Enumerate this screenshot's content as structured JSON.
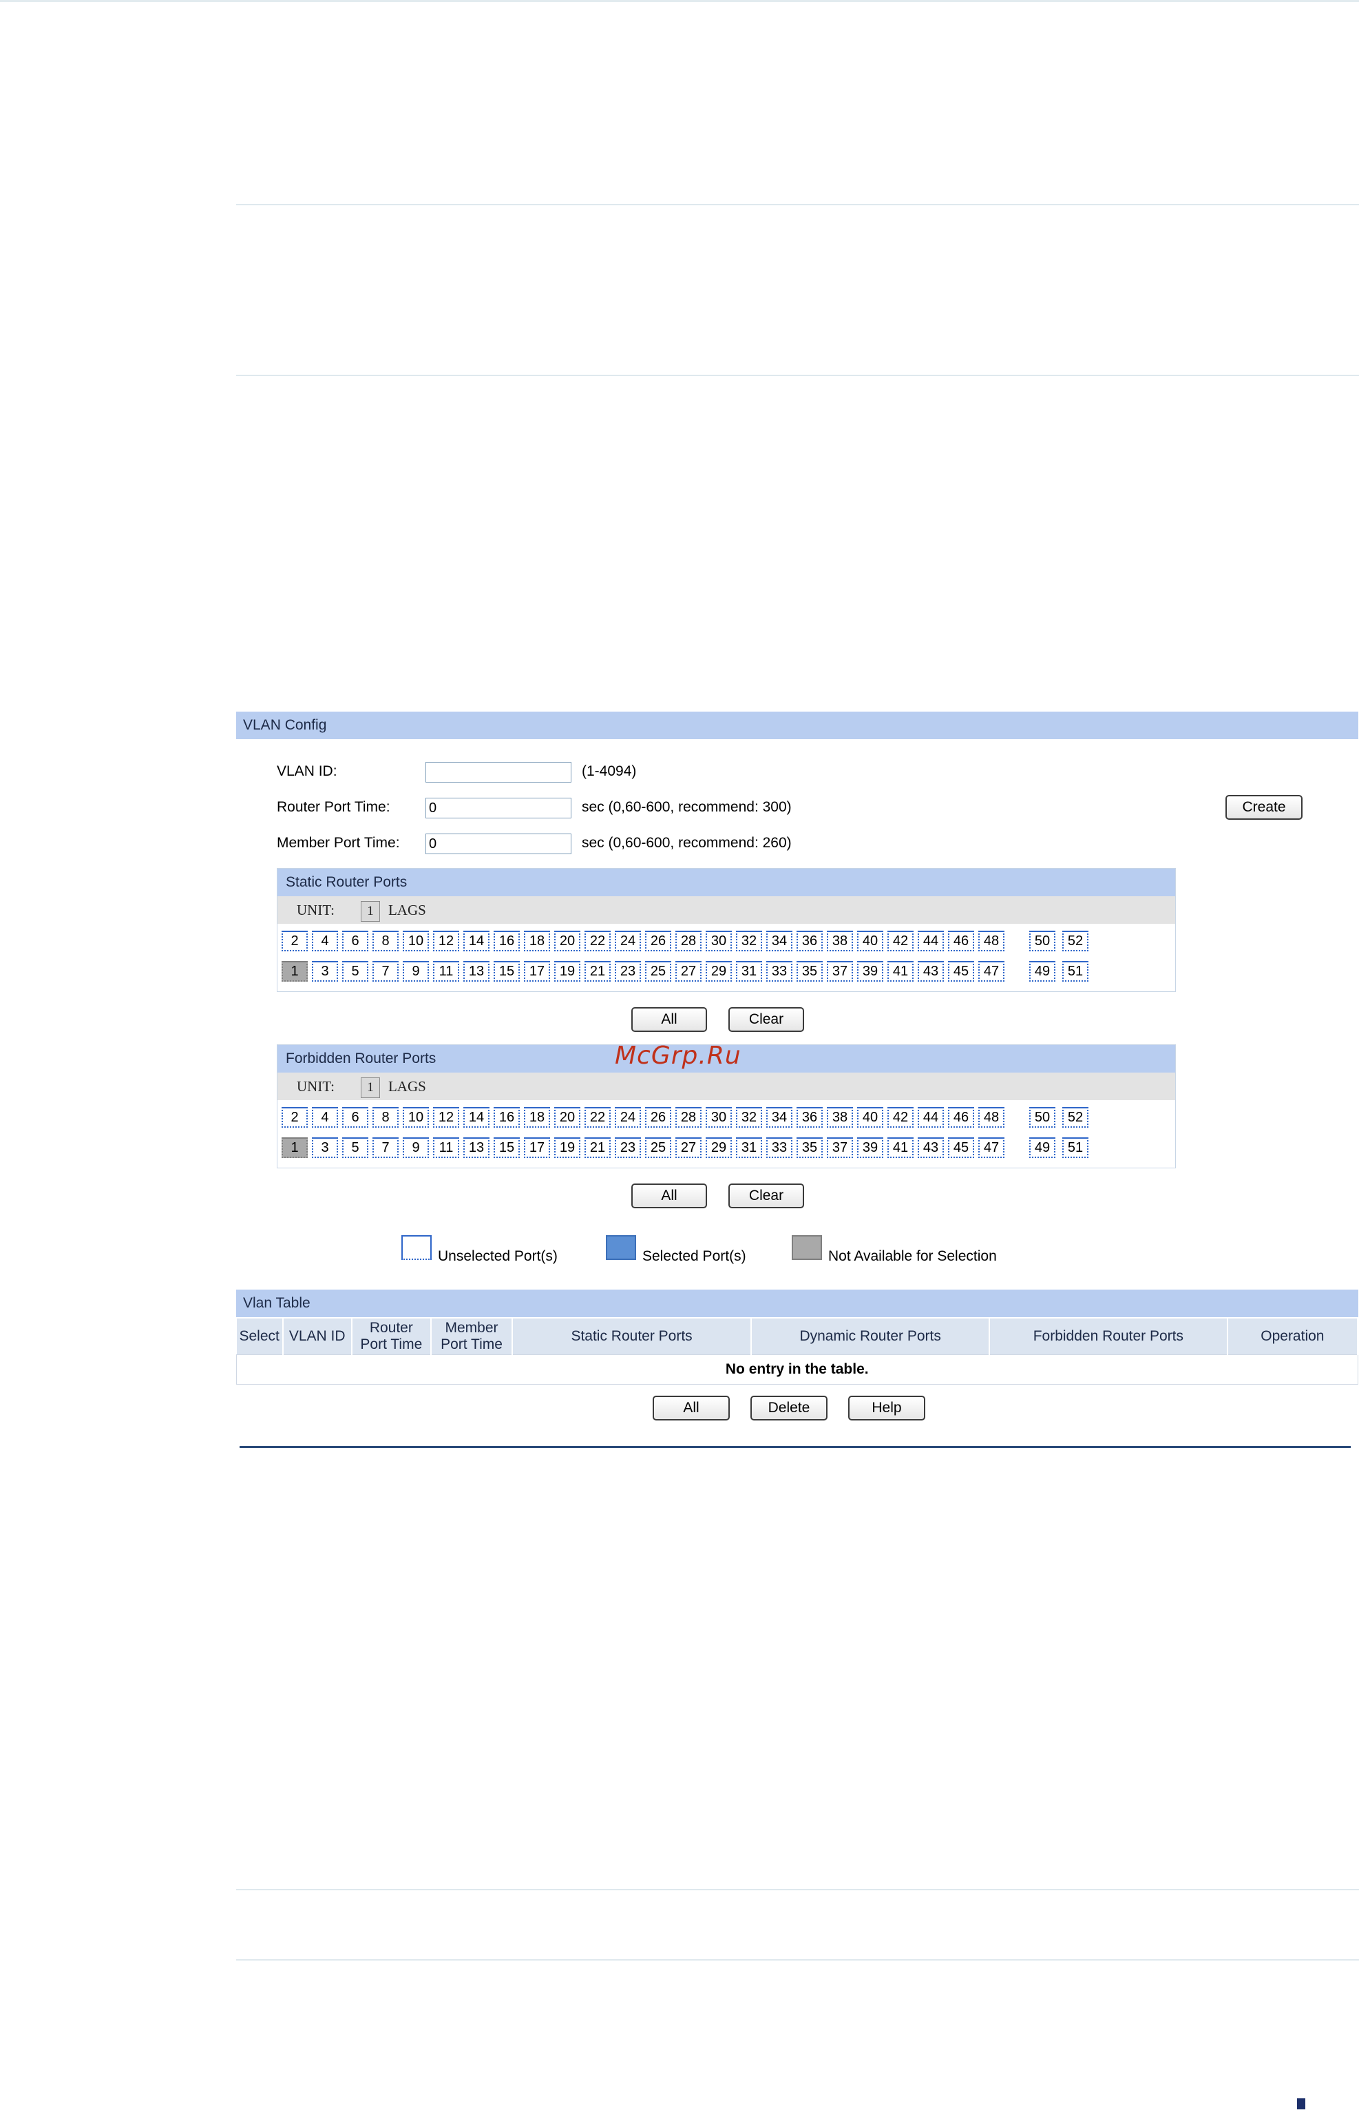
{
  "vlan_config": {
    "title": "VLAN Config",
    "vlan_id_label": "VLAN ID:",
    "vlan_id_value": "",
    "vlan_id_hint": "(1-4094)",
    "router_port_time_label": "Router Port Time:",
    "router_port_time_value": "0",
    "router_port_time_hint": "sec (0,60-600, recommend: 300)",
    "member_port_time_label": "Member Port Time:",
    "member_port_time_value": "0",
    "member_port_time_hint": "sec (0,60-600, recommend: 260)",
    "create_label": "Create"
  },
  "static_router_ports": {
    "title": "Static Router Ports",
    "unit_label": "UNIT:",
    "unit_value": "1",
    "lags_label": "LAGS",
    "all_label": "All",
    "clear_label": "Clear"
  },
  "forbidden_router_ports": {
    "title": "Forbidden Router Ports",
    "unit_label": "UNIT:",
    "unit_value": "1",
    "lags_label": "LAGS",
    "all_label": "All",
    "clear_label": "Clear"
  },
  "ports": {
    "even_row": [
      "2",
      "4",
      "6",
      "8",
      "10",
      "12",
      "14",
      "16",
      "18",
      "20",
      "22",
      "24",
      "26",
      "28",
      "30",
      "32",
      "34",
      "36",
      "38",
      "40",
      "42",
      "44",
      "46",
      "48"
    ],
    "odd_row": [
      "1",
      "3",
      "5",
      "7",
      "9",
      "11",
      "13",
      "15",
      "17",
      "19",
      "21",
      "23",
      "25",
      "27",
      "29",
      "31",
      "33",
      "35",
      "37",
      "39",
      "41",
      "43",
      "45",
      "47"
    ],
    "even_extra": [
      "50",
      "52"
    ],
    "odd_extra": [
      "49",
      "51"
    ],
    "not_available": [
      "1"
    ]
  },
  "watermark": "McGrp.Ru",
  "legend": {
    "unselected": "Unselected Port(s)",
    "selected": "Selected Port(s)",
    "not_available": "Not Available for Selection"
  },
  "vlan_table": {
    "title": "Vlan Table",
    "col_select": "Select",
    "col_vlan_id": "VLAN ID",
    "col_router_port_time_1": "Router",
    "col_router_port_time_2": "Port Time",
    "col_member_port_time_1": "Member",
    "col_member_port_time_2": "Port Time",
    "col_static": "Static Router Ports",
    "col_dynamic": "Dynamic Router Ports",
    "col_forbidden": "Forbidden Router Ports",
    "col_operation": "Operation",
    "empty_text": "No entry in the table.",
    "all_label": "All",
    "delete_label": "Delete",
    "help_label": "Help"
  },
  "colors": {
    "section_header": "#b8cdf0",
    "port_border": "#2f66c9",
    "not_available": "#a9a9a9",
    "selected": "#5b8fd4"
  }
}
